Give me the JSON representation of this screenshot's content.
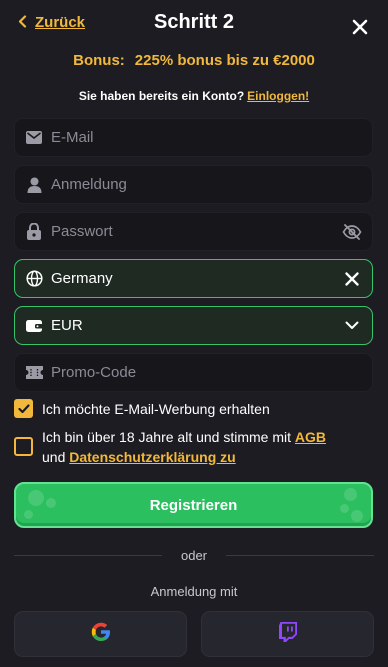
{
  "header": {
    "back_label": "Zurück",
    "title": "Schritt 2"
  },
  "bonus": {
    "label": "Bonus:",
    "text": "225% bonus bis zu €2000"
  },
  "account": {
    "question": "Sie haben bereits ein Konto?",
    "login_link": "Einloggen!"
  },
  "form": {
    "email_placeholder": "E-Mail",
    "username_placeholder": "Anmeldung",
    "password_placeholder": "Passwort",
    "country_value": "Germany",
    "currency_value": "EUR",
    "promo_placeholder": "Promo-Code"
  },
  "checkboxes": {
    "marketing_label": "Ich möchte E-Mail-Werbung erhalten",
    "marketing_checked": true,
    "terms_prefix": "Ich bin über 18 Jahre alt und stimme mit",
    "terms_link": "AGB",
    "terms_and": "und",
    "privacy_link": "Datenschutzerklärung zu",
    "terms_checked": false
  },
  "register_label": "Registrieren",
  "divider_label": "oder",
  "social": {
    "label": "Anmeldung mit",
    "providers": [
      "google-icon",
      "twitch-icon"
    ]
  },
  "colors": {
    "accent": "#f2b83b",
    "green": "#2bbf5f",
    "background": "#1c1c22"
  }
}
